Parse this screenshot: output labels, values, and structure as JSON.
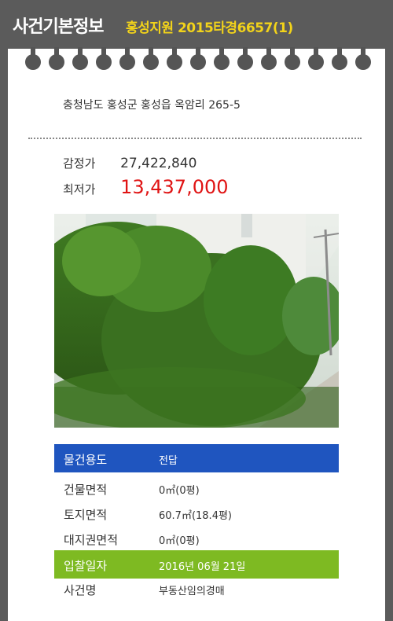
{
  "header": {
    "title": "사건기본정보",
    "court_case": "홍성지원 2015타경6657(1)"
  },
  "address": "충청남도 홍성군 홍성읍 옥암리 265-5",
  "prices": {
    "appraisal_label": "감정가",
    "appraisal_value": "27,422,840",
    "minimum_label": "최저가",
    "minimum_value": "13,437,000"
  },
  "info": {
    "usage_label": "물건용도",
    "usage_value": "전답",
    "building_area_label": "건물면적",
    "building_area_value": "0㎡(0평)",
    "land_area_label": "토지면적",
    "land_area_value": "60.7㎡(18.4평)",
    "land_right_label": "대지권면적",
    "land_right_value": "0㎡(0평)",
    "bid_date_label": "입찰일자",
    "bid_date_value": "2016년 06월 21일",
    "case_name_label": "사건명",
    "case_name_value": "부동산임의경매"
  },
  "colors": {
    "background": "#5b5b5b",
    "court_text": "#f2d31a",
    "minimum_price": "#e01414",
    "usage_bar": "#1f55bf",
    "bid_date_bar": "#7eba22"
  }
}
